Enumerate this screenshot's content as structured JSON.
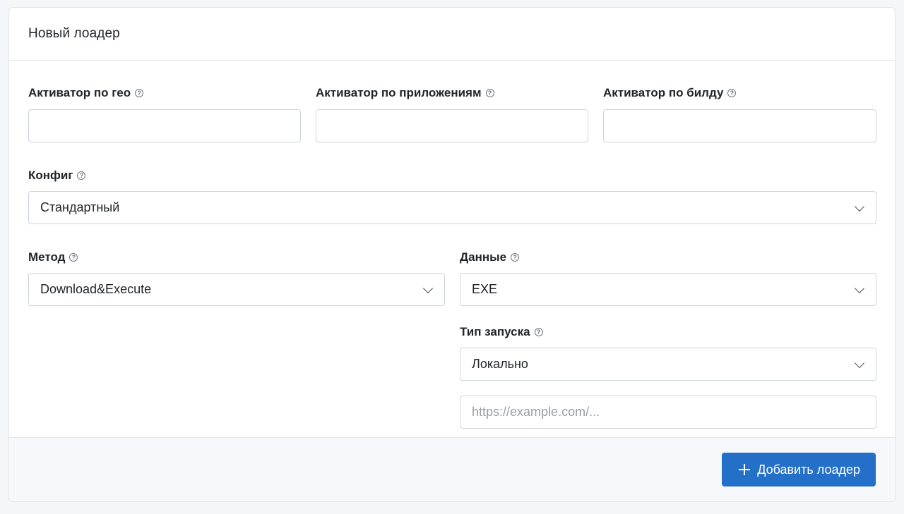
{
  "card": {
    "title": "Новый лоадер"
  },
  "fields": {
    "geo_activator": {
      "label": "Активатор по гео",
      "value": ""
    },
    "app_activator": {
      "label": "Активатор по приложениям",
      "value": ""
    },
    "build_activator": {
      "label": "Активатор по билду",
      "value": ""
    },
    "config": {
      "label": "Конфиг",
      "selected": "Стандартный"
    },
    "method": {
      "label": "Метод",
      "selected": "Download&Execute"
    },
    "data": {
      "label": "Данные",
      "selected": "EXE"
    },
    "launch_type": {
      "label": "Тип запуска",
      "selected": "Локально"
    },
    "url": {
      "placeholder": "https://example.com/...",
      "value": ""
    }
  },
  "footer": {
    "add_button_label": "Добавить лоадер"
  },
  "icons": {
    "help": "question-circle-icon",
    "chevron": "chevron-down-icon",
    "add": "plus-icon"
  },
  "colors": {
    "primary": "#2470c8",
    "border": "#ced4da",
    "background": "#f4f6f9"
  }
}
